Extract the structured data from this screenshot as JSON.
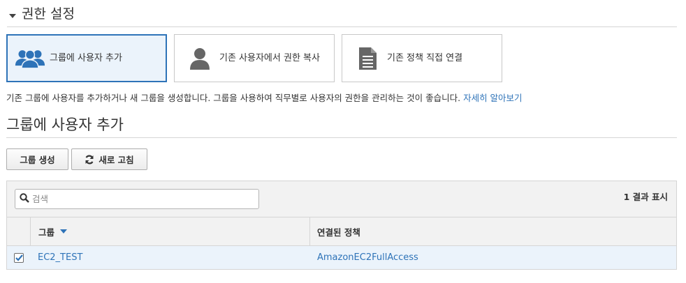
{
  "section": {
    "title": "권한 설정"
  },
  "options": [
    {
      "label": "그룹에 사용자 추가",
      "icon": "users-group-icon",
      "selected": true
    },
    {
      "label": "기존 사용자에서 권한 복사",
      "icon": "user-icon",
      "selected": false
    },
    {
      "label": "기존 정책 직접 연결",
      "icon": "document-icon",
      "selected": false
    }
  ],
  "description": {
    "text": "기존 그룹에 사용자를 추가하거나 새 그룹을 생성합니다. 그룹을 사용하여 직무별로 사용자의 권한을 관리하는 것이 좋습니다. ",
    "link": "자세히 알아보기"
  },
  "subheader": {
    "title": "그룹에 사용자 추가"
  },
  "toolbar": {
    "create_group_label": "그룹 생성",
    "refresh_label": "새로 고침"
  },
  "search": {
    "placeholder": "검색",
    "value": ""
  },
  "result_count": "1 결과 표시",
  "table": {
    "columns": [
      "그룹",
      "연결된 정책"
    ],
    "rows": [
      {
        "checked": true,
        "group": "EC2_TEST",
        "policy": "AmazonEC2FullAccess"
      }
    ]
  },
  "colors": {
    "accent": "#2e73b8",
    "selected_bg": "#ebf3fb",
    "icon_blue": "#2e73b8",
    "icon_gray": "#666666"
  }
}
